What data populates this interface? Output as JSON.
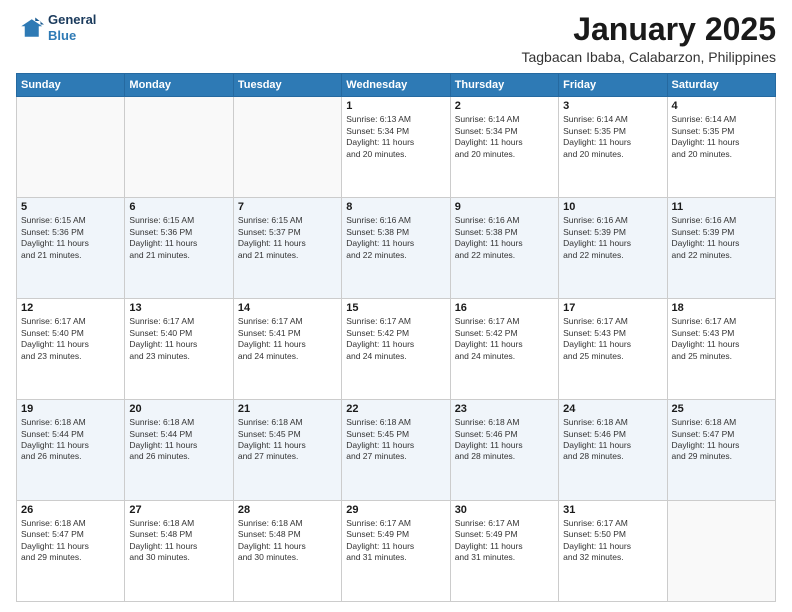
{
  "logo": {
    "line1": "General",
    "line2": "Blue"
  },
  "title": "January 2025",
  "location": "Tagbacan Ibaba, Calabarzon, Philippines",
  "days_header": [
    "Sunday",
    "Monday",
    "Tuesday",
    "Wednesday",
    "Thursday",
    "Friday",
    "Saturday"
  ],
  "weeks": [
    [
      {
        "day": "",
        "info": ""
      },
      {
        "day": "",
        "info": ""
      },
      {
        "day": "",
        "info": ""
      },
      {
        "day": "1",
        "info": "Sunrise: 6:13 AM\nSunset: 5:34 PM\nDaylight: 11 hours\nand 20 minutes."
      },
      {
        "day": "2",
        "info": "Sunrise: 6:14 AM\nSunset: 5:34 PM\nDaylight: 11 hours\nand 20 minutes."
      },
      {
        "day": "3",
        "info": "Sunrise: 6:14 AM\nSunset: 5:35 PM\nDaylight: 11 hours\nand 20 minutes."
      },
      {
        "day": "4",
        "info": "Sunrise: 6:14 AM\nSunset: 5:35 PM\nDaylight: 11 hours\nand 20 minutes."
      }
    ],
    [
      {
        "day": "5",
        "info": "Sunrise: 6:15 AM\nSunset: 5:36 PM\nDaylight: 11 hours\nand 21 minutes."
      },
      {
        "day": "6",
        "info": "Sunrise: 6:15 AM\nSunset: 5:36 PM\nDaylight: 11 hours\nand 21 minutes."
      },
      {
        "day": "7",
        "info": "Sunrise: 6:15 AM\nSunset: 5:37 PM\nDaylight: 11 hours\nand 21 minutes."
      },
      {
        "day": "8",
        "info": "Sunrise: 6:16 AM\nSunset: 5:38 PM\nDaylight: 11 hours\nand 22 minutes."
      },
      {
        "day": "9",
        "info": "Sunrise: 6:16 AM\nSunset: 5:38 PM\nDaylight: 11 hours\nand 22 minutes."
      },
      {
        "day": "10",
        "info": "Sunrise: 6:16 AM\nSunset: 5:39 PM\nDaylight: 11 hours\nand 22 minutes."
      },
      {
        "day": "11",
        "info": "Sunrise: 6:16 AM\nSunset: 5:39 PM\nDaylight: 11 hours\nand 22 minutes."
      }
    ],
    [
      {
        "day": "12",
        "info": "Sunrise: 6:17 AM\nSunset: 5:40 PM\nDaylight: 11 hours\nand 23 minutes."
      },
      {
        "day": "13",
        "info": "Sunrise: 6:17 AM\nSunset: 5:40 PM\nDaylight: 11 hours\nand 23 minutes."
      },
      {
        "day": "14",
        "info": "Sunrise: 6:17 AM\nSunset: 5:41 PM\nDaylight: 11 hours\nand 24 minutes."
      },
      {
        "day": "15",
        "info": "Sunrise: 6:17 AM\nSunset: 5:42 PM\nDaylight: 11 hours\nand 24 minutes."
      },
      {
        "day": "16",
        "info": "Sunrise: 6:17 AM\nSunset: 5:42 PM\nDaylight: 11 hours\nand 24 minutes."
      },
      {
        "day": "17",
        "info": "Sunrise: 6:17 AM\nSunset: 5:43 PM\nDaylight: 11 hours\nand 25 minutes."
      },
      {
        "day": "18",
        "info": "Sunrise: 6:17 AM\nSunset: 5:43 PM\nDaylight: 11 hours\nand 25 minutes."
      }
    ],
    [
      {
        "day": "19",
        "info": "Sunrise: 6:18 AM\nSunset: 5:44 PM\nDaylight: 11 hours\nand 26 minutes."
      },
      {
        "day": "20",
        "info": "Sunrise: 6:18 AM\nSunset: 5:44 PM\nDaylight: 11 hours\nand 26 minutes."
      },
      {
        "day": "21",
        "info": "Sunrise: 6:18 AM\nSunset: 5:45 PM\nDaylight: 11 hours\nand 27 minutes."
      },
      {
        "day": "22",
        "info": "Sunrise: 6:18 AM\nSunset: 5:45 PM\nDaylight: 11 hours\nand 27 minutes."
      },
      {
        "day": "23",
        "info": "Sunrise: 6:18 AM\nSunset: 5:46 PM\nDaylight: 11 hours\nand 28 minutes."
      },
      {
        "day": "24",
        "info": "Sunrise: 6:18 AM\nSunset: 5:46 PM\nDaylight: 11 hours\nand 28 minutes."
      },
      {
        "day": "25",
        "info": "Sunrise: 6:18 AM\nSunset: 5:47 PM\nDaylight: 11 hours\nand 29 minutes."
      }
    ],
    [
      {
        "day": "26",
        "info": "Sunrise: 6:18 AM\nSunset: 5:47 PM\nDaylight: 11 hours\nand 29 minutes."
      },
      {
        "day": "27",
        "info": "Sunrise: 6:18 AM\nSunset: 5:48 PM\nDaylight: 11 hours\nand 30 minutes."
      },
      {
        "day": "28",
        "info": "Sunrise: 6:18 AM\nSunset: 5:48 PM\nDaylight: 11 hours\nand 30 minutes."
      },
      {
        "day": "29",
        "info": "Sunrise: 6:17 AM\nSunset: 5:49 PM\nDaylight: 11 hours\nand 31 minutes."
      },
      {
        "day": "30",
        "info": "Sunrise: 6:17 AM\nSunset: 5:49 PM\nDaylight: 11 hours\nand 31 minutes."
      },
      {
        "day": "31",
        "info": "Sunrise: 6:17 AM\nSunset: 5:50 PM\nDaylight: 11 hours\nand 32 minutes."
      },
      {
        "day": "",
        "info": ""
      }
    ]
  ]
}
